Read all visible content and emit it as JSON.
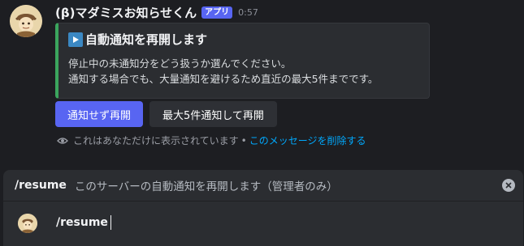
{
  "message": {
    "username": "(β)マダミスお知らせくん",
    "app_badge": "アプリ",
    "timestamp": "0:57",
    "avatar_icon": "detective-character-avatar",
    "embed": {
      "accent_color": "#3ba55d",
      "title_icon": "play-button-icon",
      "title": "自動通知を再開します",
      "lines": [
        "停止中の未通知分をどう扱うか選んでください。",
        "通知する場合でも、大量通知を避けるため直近の最大5件までです。"
      ]
    },
    "buttons": {
      "resume_without_notify": "通知せず再開",
      "resume_with_notify": "最大5件通知して再開"
    },
    "ephemeral": {
      "notice": "これはあなただけに表示されています",
      "separator": "•",
      "delete_link": "このメッセージを削除する"
    }
  },
  "command_popup": {
    "name": "/resume",
    "description": "このサーバーの自動通知を再開します（管理者のみ）"
  },
  "composer": {
    "value": "/resume",
    "avatar_icon": "detective-character-avatar"
  },
  "colors": {
    "blurple": "#5865f2",
    "link": "#00a8fc"
  }
}
